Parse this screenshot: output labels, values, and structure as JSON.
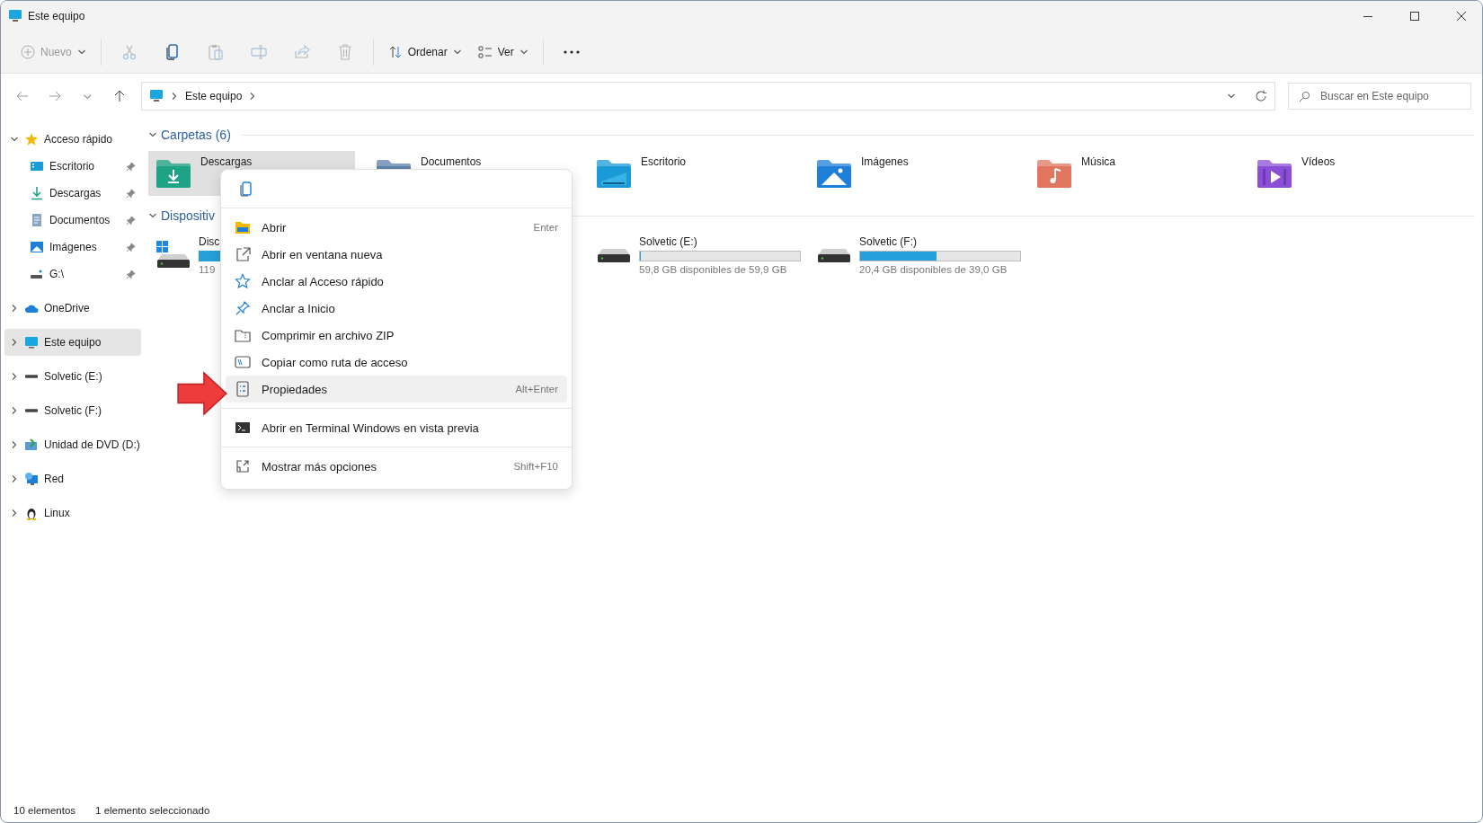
{
  "window": {
    "title": "Este equipo"
  },
  "toolbar": {
    "new": {
      "label": "Nuevo",
      "disabled": true
    },
    "actions": [
      {
        "kind": "cut",
        "disabled": true
      },
      {
        "kind": "copy",
        "disabled": false
      },
      {
        "kind": "paste",
        "disabled": true
      },
      {
        "kind": "rename",
        "disabled": true
      },
      {
        "kind": "share",
        "disabled": true
      },
      {
        "kind": "delete",
        "disabled": true
      }
    ],
    "sort": {
      "label": "Ordenar"
    },
    "view": {
      "label": "Ver"
    }
  },
  "address_bar": {
    "path": [
      "Este equipo"
    ]
  },
  "search": {
    "placeholder": "Buscar en Este equipo"
  },
  "sidebar": {
    "items": [
      {
        "label": "Acceso rápido",
        "kind": "star",
        "expanded": true,
        "selected": false,
        "children": [
          {
            "label": "Escritorio",
            "kind": "desktop",
            "pinned": true
          },
          {
            "label": "Descargas",
            "kind": "downloads",
            "pinned": true
          },
          {
            "label": "Documentos",
            "kind": "documents",
            "pinned": true
          },
          {
            "label": "Imágenes",
            "kind": "pictures",
            "pinned": true
          },
          {
            "label": "G:\\",
            "kind": "netdrive",
            "pinned": true
          }
        ]
      },
      {
        "label": "OneDrive",
        "kind": "cloud",
        "expanded": false,
        "selected": false
      },
      {
        "label": "Este equipo",
        "kind": "pc",
        "expanded": false,
        "selected": true
      },
      {
        "label": "Solvetic (E:)",
        "kind": "drive",
        "expanded": false,
        "selected": false
      },
      {
        "label": "Solvetic (F:)",
        "kind": "drive",
        "expanded": false,
        "selected": false
      },
      {
        "label": "Unidad de DVD (D:)",
        "kind": "dvd",
        "expanded": false,
        "selected": false
      },
      {
        "label": "Red",
        "kind": "network",
        "expanded": false,
        "selected": false
      },
      {
        "label": "Linux",
        "kind": "linux",
        "expanded": false,
        "selected": false
      }
    ]
  },
  "content": {
    "sections": [
      {
        "title": "Carpetas (6)",
        "kind": "folders",
        "expanded": true,
        "items": [
          {
            "name": "Descargas",
            "kind": "downloads",
            "selected": true
          },
          {
            "name": "Documentos",
            "kind": "documents",
            "selected": false
          },
          {
            "name": "Escritorio",
            "kind": "desktop",
            "selected": false
          },
          {
            "name": "Imágenes",
            "kind": "pictures",
            "selected": false
          },
          {
            "name": "Música",
            "kind": "music",
            "selected": false
          },
          {
            "name": "Vídeos",
            "kind": "videos",
            "selected": false
          }
        ]
      },
      {
        "title": "Dispositiv",
        "kind": "drives",
        "expanded": true,
        "items": [
          {
            "name": "Disc",
            "kind": "system",
            "detail": "119"
          },
          {
            "name": "Solvetic (E:)",
            "kind": "drive",
            "level": 0.002,
            "detail": "59,8 GB disponibles de 59,9 GB"
          },
          {
            "name": "Solvetic (F:)",
            "kind": "drive",
            "level": 0.48,
            "detail": "20,4 GB disponibles de 39,0 GB"
          }
        ]
      }
    ]
  },
  "context_menu": {
    "quick_actions": [
      {
        "kind": "copy"
      }
    ],
    "groups": [
      [
        {
          "label": "Abrir",
          "kind": "open",
          "shortcut": "Enter",
          "selected": false
        },
        {
          "label": "Abrir en ventana nueva",
          "kind": "new-window",
          "selected": false
        },
        {
          "label": "Anclar al Acceso rápido",
          "kind": "star",
          "selected": false
        },
        {
          "label": "Anclar a Inicio",
          "kind": "pin",
          "selected": false
        },
        {
          "label": "Comprimir en archivo ZIP",
          "kind": "zip",
          "selected": false
        },
        {
          "label": "Copiar como ruta de acceso",
          "kind": "path",
          "selected": false
        },
        {
          "label": "Propiedades",
          "kind": "properties",
          "shortcut": "Alt+Enter",
          "selected": true
        }
      ],
      [
        {
          "label": "Abrir en Terminal Windows en vista previa",
          "kind": "terminal",
          "selected": false
        }
      ],
      [
        {
          "label": "Mostrar más opciones",
          "kind": "more",
          "shortcut": "Shift+F10",
          "selected": false
        }
      ]
    ]
  },
  "status_bar": [
    "10 elementos",
    "1 elemento seleccionado"
  ]
}
